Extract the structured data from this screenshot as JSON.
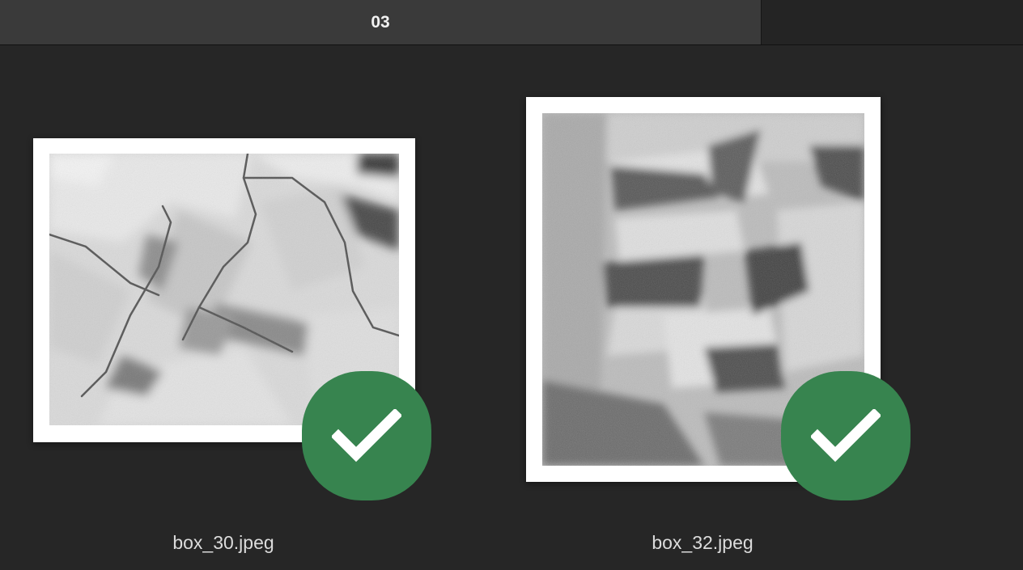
{
  "tabs": [
    {
      "label": "03",
      "active": true
    }
  ],
  "thumbnails": [
    {
      "filename": "box_30.jpeg",
      "selected": true,
      "icon": "checkmark-icon"
    },
    {
      "filename": "box_32.jpeg",
      "selected": true,
      "icon": "checkmark-icon"
    }
  ],
  "colors": {
    "background": "#262626",
    "tab_active": "#3a3a3a",
    "tab_inactive": "#242424",
    "badge": "#37844f",
    "frame": "#ffffff"
  }
}
